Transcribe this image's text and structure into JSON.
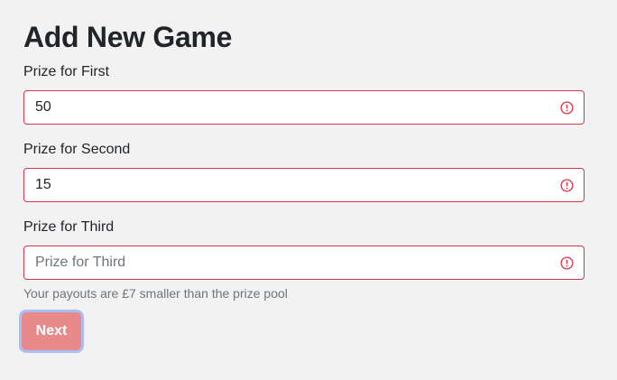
{
  "page": {
    "title": "Add New Game"
  },
  "form": {
    "first": {
      "label": "Prize for First",
      "value": "50",
      "placeholder": "Prize for First"
    },
    "second": {
      "label": "Prize for Second",
      "value": "15",
      "placeholder": "Prize for Second"
    },
    "third": {
      "label": "Prize for Third",
      "value": "",
      "placeholder": "Prize for Third",
      "help": "Your payouts are £7 smaller than the prize pool"
    },
    "next_label": "Next"
  },
  "icons": {
    "error": "exclamation-circle-icon"
  },
  "colors": {
    "error": "#dc3545",
    "button": "#e98a8a",
    "focus_ring": "#a9bff3",
    "background": "#f2f2f2"
  }
}
